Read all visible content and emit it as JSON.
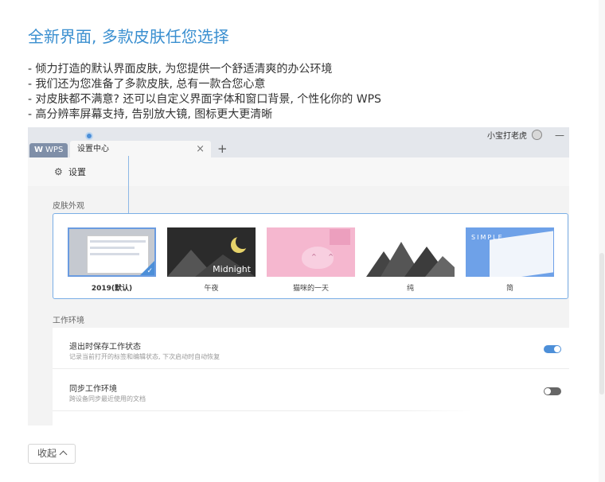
{
  "page": {
    "title": "全新界面, 多款皮肤任您选择",
    "features": [
      "- 倾力打造的默认界面皮肤, 为您提供一个舒适清爽的办公环境",
      "- 我们还为您准备了多款皮肤, 总有一款合您心意",
      "- 对皮肤都不满意? 还可以自定义界面字体和窗口背景, 个性化你的 WPS",
      "- 高分辨率屏幕支持, 告别放大镜, 图标更大更清晰"
    ],
    "collapse_label": "收起"
  },
  "screenshot": {
    "wps_tab_label": "WPS",
    "doc_tab_label": "设置中心",
    "new_tab": "+",
    "close_tab": "×",
    "user_name": "小宝打老虎",
    "minimize": "—",
    "settings_title": "设置",
    "skin_section_label": "皮肤外观",
    "skins": [
      {
        "name": "2019(默认)",
        "selected": true
      },
      {
        "name": "午夜",
        "thumb_label": "Midnight"
      },
      {
        "name": "猫咪的一天"
      },
      {
        "name": "纯"
      },
      {
        "name": "简",
        "thumb_label": "SIMPLE"
      }
    ],
    "work_section_label": "工作环境",
    "work_items": [
      {
        "title": "退出时保存工作状态",
        "desc": "记录当前打开的标签和编辑状态, 下次启动时自动恢复",
        "enabled": true
      },
      {
        "title": "同步工作环境",
        "desc": "跨设备同步最近使用的文档",
        "enabled": false
      }
    ]
  },
  "colors": {
    "accent": "#3a8fd0",
    "toggle_on": "#4d8fd8",
    "toggle_off": "#666666"
  }
}
